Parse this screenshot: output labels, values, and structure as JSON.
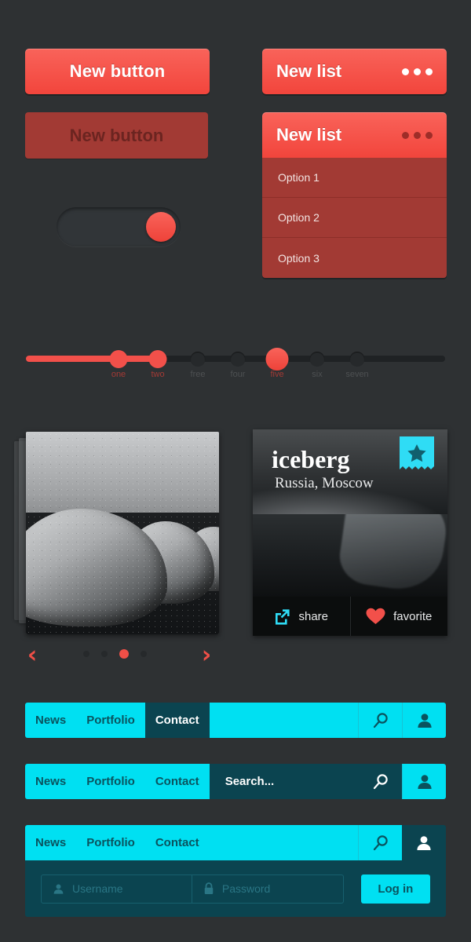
{
  "theme": {
    "background": "#2e3133",
    "red": "#f2504a",
    "red_dark": "#a23a34",
    "cyan": "#00e0f2",
    "teal_dark": "#0b4450"
  },
  "buttons": {
    "primary_label": "New button",
    "disabled_label": "New button"
  },
  "toggle": {
    "name": "toggle-switch",
    "state": "on"
  },
  "list_collapsed": {
    "title": "New list",
    "menu_icon": "ellipsis-icon"
  },
  "list_open": {
    "title": "New list",
    "menu_icon": "ellipsis-icon",
    "options": [
      "Option 1",
      "Option 2",
      "Option 3"
    ]
  },
  "slider": {
    "ticks": [
      {
        "label": "one",
        "state": "filled"
      },
      {
        "label": "two",
        "state": "filled"
      },
      {
        "label": "free",
        "state": "empty"
      },
      {
        "label": "four",
        "state": "empty"
      },
      {
        "label": "five",
        "state": "active"
      },
      {
        "label": "six",
        "state": "empty"
      },
      {
        "label": "seven",
        "state": "empty"
      }
    ]
  },
  "carousel": {
    "prev_icon": "chevron-left-icon",
    "next_icon": "chevron-right-icon",
    "pages": 4,
    "active_page": 3
  },
  "iceberg_card": {
    "title": "iceberg",
    "subtitle": "Russia, Moscow",
    "badge_icon": "star-ribbon-icon",
    "actions": [
      {
        "icon": "share-icon",
        "label": "share"
      },
      {
        "icon": "heart-icon",
        "label": "favorite"
      }
    ]
  },
  "navbar_1": {
    "links": [
      {
        "label": "News",
        "active": false
      },
      {
        "label": "Portfolio",
        "active": false
      },
      {
        "label": "Contact",
        "active": true
      }
    ],
    "search_icon": "search-icon",
    "user_icon": "user-icon"
  },
  "navbar_2": {
    "links": [
      {
        "label": "News",
        "active": false
      },
      {
        "label": "Portfolio",
        "active": false
      },
      {
        "label": "Contact",
        "active": false
      }
    ],
    "search_placeholder": "Search...",
    "search_icon": "search-icon",
    "user_icon": "user-icon"
  },
  "navbar_3": {
    "links": [
      {
        "label": "News",
        "active": false
      },
      {
        "label": "Portfolio",
        "active": false
      },
      {
        "label": "Contact",
        "active": false
      }
    ],
    "search_icon": "search-icon",
    "user_icon": "user-icon",
    "login": {
      "username_placeholder": "Username",
      "username_icon": "user-icon",
      "password_placeholder": "Password",
      "password_icon": "lock-icon",
      "submit_label": "Log in"
    }
  }
}
